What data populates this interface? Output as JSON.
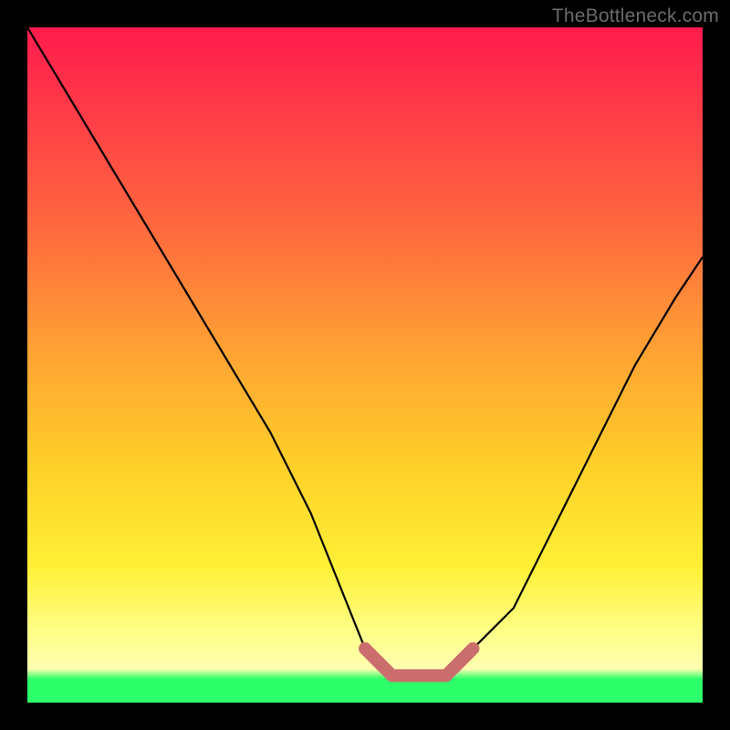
{
  "watermark": "TheBottleneck.com",
  "chart_data": {
    "type": "line",
    "title": "",
    "xlabel": "",
    "ylabel": "",
    "xlim": [
      0,
      100
    ],
    "ylim": [
      0,
      100
    ],
    "series": [
      {
        "name": "bottleneck-curve",
        "x": [
          0,
          6,
          12,
          18,
          24,
          30,
          36,
          42,
          46,
          50,
          54,
          58,
          62,
          66,
          72,
          78,
          84,
          90,
          96,
          100
        ],
        "y": [
          100,
          90,
          80,
          70,
          60,
          50,
          40,
          28,
          18,
          8,
          4,
          4,
          4,
          8,
          14,
          26,
          38,
          50,
          60,
          66
        ]
      },
      {
        "name": "optimal-band",
        "x": [
          50,
          54,
          58,
          62,
          66
        ],
        "y": [
          8,
          4,
          4,
          4,
          8
        ]
      }
    ],
    "colors": {
      "curve": "#000000",
      "optimal_band": "#cc6d6d",
      "gradient_top": "#ff1b4d",
      "gradient_mid": "#ffd029",
      "gradient_bottom": "#2dff6a"
    }
  }
}
